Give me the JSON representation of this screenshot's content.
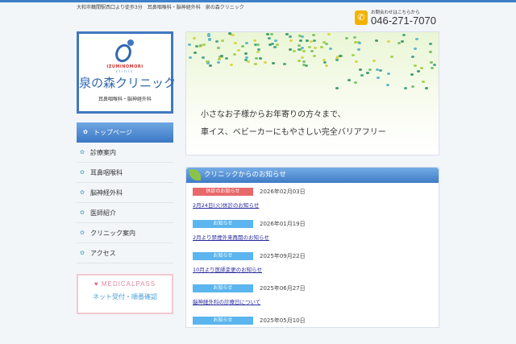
{
  "header": {
    "tagline": "大和市鶴間駅西口より徒歩3分　耳鼻咽喉科・脳神経外科　泉の森クリニック",
    "contact_label": "お問合わせはこちらから",
    "phone": "046-271-7070"
  },
  "logo": {
    "en": "IZUMINOMORI",
    "sub": "clinic",
    "name": "泉の森クリニック",
    "depts": "耳鼻咽喉科・脳神経外科"
  },
  "nav": {
    "items": [
      "トップページ",
      "診療案内",
      "耳鼻咽喉科",
      "脳神経外科",
      "医師紹介",
      "クリニック案内",
      "アクセス"
    ]
  },
  "medicalpass": {
    "title": "MEDICALPASS",
    "sub": "ネット受付・順番確認"
  },
  "hero": {
    "line1": "小さなお子様からお年寄りの方々まで、",
    "line2": "車イス、ベビーカーにもやさしい完全バリアフリー"
  },
  "news": {
    "heading": "クリニックからのお知らせ",
    "entries": [
      {
        "badge": "休診のお知らせ",
        "badge_color": "#e8696a",
        "date": "2026年02月03日",
        "title": "2月24日(火)休診のお知らせ"
      },
      {
        "badge": "お知らせ",
        "badge_color": "#5bb5ee",
        "date": "2026年01月19日",
        "title": "2月より禁煙外来再開のお知らせ"
      },
      {
        "badge": "お知らせ",
        "badge_color": "#5bb5ee",
        "date": "2025年09月22日",
        "title": "10月より医師変更のお知らせ"
      },
      {
        "badge": "お知らせ",
        "badge_color": "#5bb5ee",
        "date": "2025年06月27日",
        "title": "脳神経外科の診療日について"
      },
      {
        "badge": "お知らせ",
        "badge_color": "#5bb5ee",
        "date": "2025年05月10日",
        "title": ""
      }
    ]
  }
}
